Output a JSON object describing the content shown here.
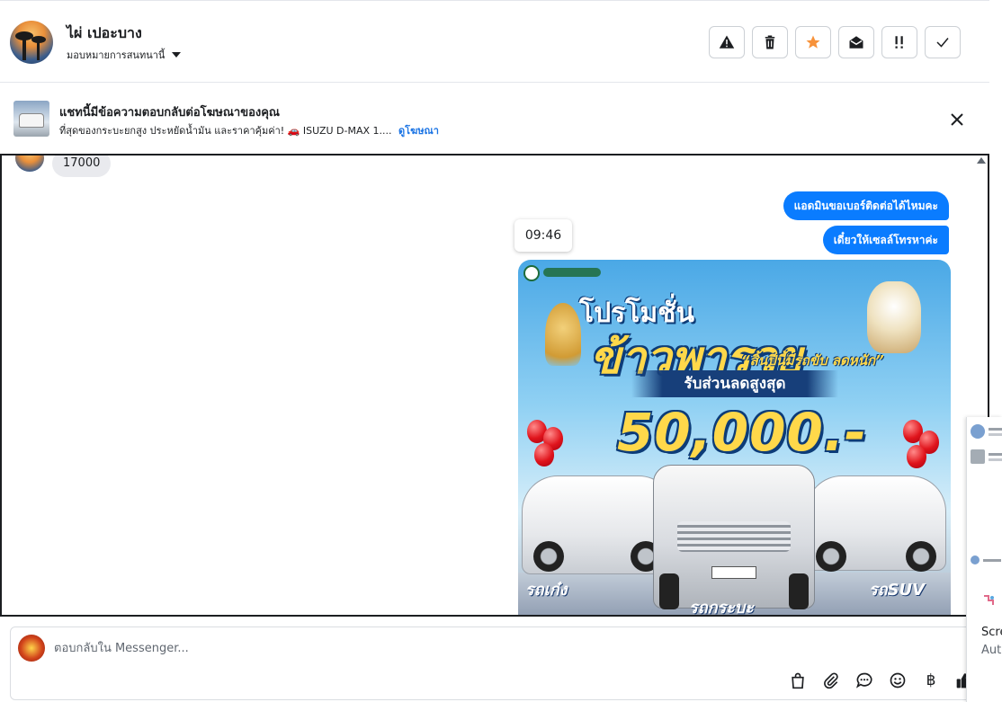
{
  "contact": {
    "name": "ไผ่ เปอะบาง",
    "assign_label": "มอบหมายการสนทนานี้"
  },
  "actions": [
    {
      "name": "spam",
      "icon": "warning-icon"
    },
    {
      "name": "delete",
      "icon": "trash-icon"
    },
    {
      "name": "follow-up",
      "icon": "star-icon",
      "color": "#f7923a"
    },
    {
      "name": "mark-unread",
      "icon": "envelope-open-icon"
    },
    {
      "name": "priority",
      "icon": "double-exclamation-icon"
    },
    {
      "name": "done",
      "icon": "check-icon"
    }
  ],
  "ad_banner": {
    "title": "แชทนี้มีข้อความตอบกลับต่อโฆษณาของคุณ",
    "description": "ที่สุดของกระบะยกสูง ประหยัดน้ำมัน และราคาคุ้มค่า! 🚗 ISUZU D-MAX 1....",
    "link_label": "ดูโฆษณา"
  },
  "messages": {
    "incoming": [
      {
        "text": "17000"
      }
    ],
    "outgoing": [
      {
        "text": "แอดมินขอเบอร์ติดต่อได้ไหมคะ"
      },
      {
        "text": "เดี๋ยวให้เซลล์โทรหาค่ะ"
      }
    ],
    "timestamp_tooltip": "09:46"
  },
  "promo_image": {
    "headline_small": "โปรโมชั่น",
    "headline_large": "ข้าวพารวย",
    "tagline": "“สิ้นปีนี้มีรถขับ ลดหนัก”",
    "ribbon": "รับส่วนลดสูงสุด",
    "amount": "50,000.-",
    "label_left": "รถเก๋ง",
    "label_center": "รถกระบะ",
    "label_right": "รถSUV"
  },
  "composer": {
    "placeholder": "ตอบกลับใน Messenger...",
    "tools": [
      "shopping-bag-icon",
      "paperclip-icon",
      "chat-bubble-icon",
      "emoji-icon",
      "baht-icon",
      "thumbs-up-icon"
    ],
    "baht_symbol": "฿"
  },
  "side_peek": {
    "label_1": "Scre",
    "label_2": "Auto"
  },
  "colors": {
    "accent": "#0a7cff",
    "link": "#1b74e4",
    "star": "#f7923a"
  }
}
